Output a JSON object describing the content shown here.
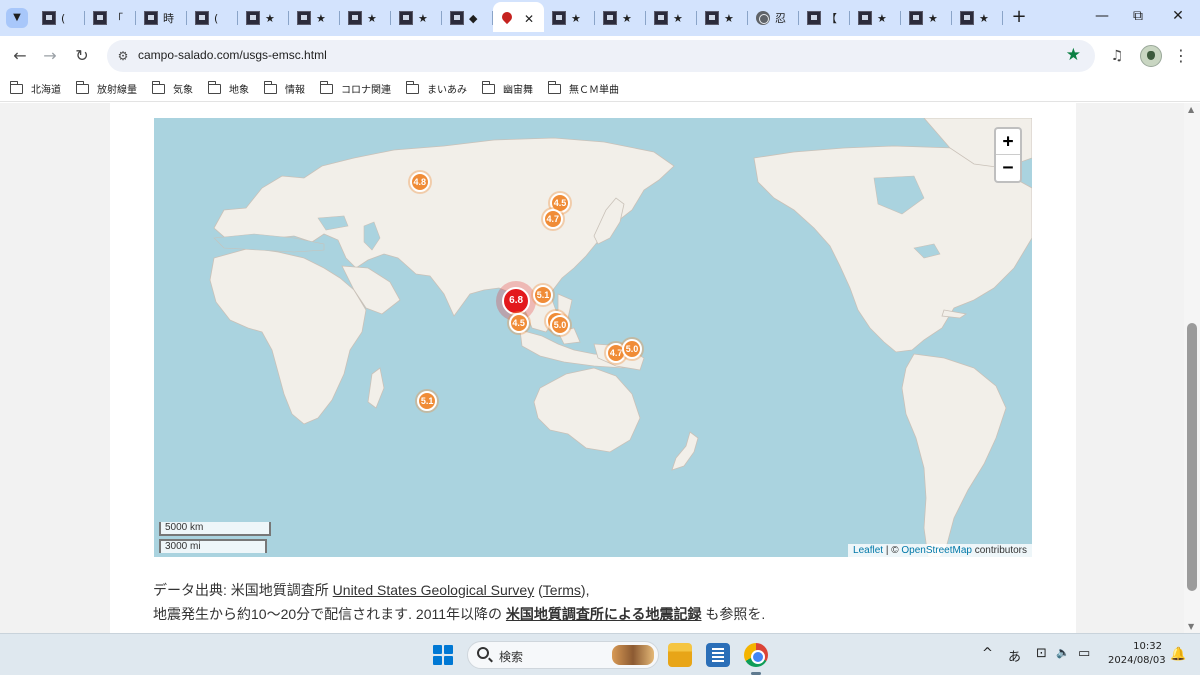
{
  "tabstrip": {
    "tabs": [
      {
        "glyph": "(",
        "icon": "site-icon"
      },
      {
        "glyph": "「",
        "icon": "site-icon"
      },
      {
        "glyph": "時",
        "icon": "site-icon"
      },
      {
        "glyph": "(",
        "icon": "site-icon"
      },
      {
        "glyph": "★",
        "icon": "site-icon"
      },
      {
        "glyph": "★",
        "icon": "site-icon"
      },
      {
        "glyph": "★",
        "icon": "site-icon"
      },
      {
        "glyph": "★",
        "icon": "site-icon"
      },
      {
        "glyph": "◆",
        "icon": "site-icon"
      },
      {
        "glyph": "",
        "icon": "map-pin-icon",
        "active": true
      },
      {
        "glyph": "★",
        "icon": "site-icon"
      },
      {
        "glyph": "★",
        "icon": "site-icon"
      },
      {
        "glyph": "★",
        "icon": "site-icon"
      },
      {
        "glyph": "★",
        "icon": "site-icon"
      },
      {
        "glyph": "忍",
        "icon": "globe-icon"
      },
      {
        "glyph": "【",
        "icon": "site-icon"
      },
      {
        "glyph": "★",
        "icon": "site-icon"
      },
      {
        "glyph": "★",
        "icon": "site-icon"
      },
      {
        "glyph": "★",
        "icon": "site-icon"
      }
    ],
    "close_glyph": "✕",
    "new_tab_glyph": "+",
    "minimize_glyph": "—",
    "restore_glyph": "⧉",
    "close_window_glyph": "✕"
  },
  "toolbar": {
    "url": "campo-salado.com/usgs-emsc.html",
    "back_glyph": "←",
    "forward_glyph": "→",
    "reload_glyph": "↻",
    "site_info_glyph": "⚙",
    "bookmark_star_glyph": "★",
    "media_glyph": "♫"
  },
  "bookmarks": [
    "北海道",
    "放射線量",
    "気象",
    "地象",
    "情報",
    "コロナ関連",
    "まいあみ",
    "幽宙舞",
    "無ＣＭ単曲"
  ],
  "map": {
    "zoom_in": "+",
    "zoom_out": "−",
    "scale_km": "5000 km",
    "scale_mi": "3000 mi",
    "attribution": {
      "leaflet": "Leaflet",
      "separator": " | © ",
      "osm": "OpenStreetMap",
      "suffix": " contributors"
    },
    "colors": {
      "ocean": "#aad3df",
      "land": "#f2efe9",
      "cluster": "#f08c37",
      "cluster_large": "#e3191c"
    },
    "markers": [
      {
        "label": "4.8",
        "lon": 87.0,
        "lat": 48.0
      },
      {
        "label": "4.5",
        "lon": 144.5,
        "lat": 42.0
      },
      {
        "label": "4.7",
        "lon": 141.5,
        "lat": 37.0
      },
      {
        "label": "6.8",
        "lon": 126.5,
        "lat": 6.0,
        "large": true
      },
      {
        "label": "5.1",
        "lon": 137.5,
        "lat": 8.5
      },
      {
        "label": "4.5",
        "lon": 127.5,
        "lat": -3.0
      },
      {
        "label": "4.6",
        "lon": 143.0,
        "lat": -2.0
      },
      {
        "label": "5.0",
        "lon": 144.5,
        "lat": -3.5
      },
      {
        "label": "4.7",
        "lon": 167.5,
        "lat": -15.0
      },
      {
        "label": "5.0",
        "lon": 174.0,
        "lat": -13.5
      },
      {
        "label": "5.1",
        "lon": 90.0,
        "lat": -33.0
      }
    ]
  },
  "source": {
    "line1_prefix": "データ出典: 米国地質調査所 ",
    "usgs_link": "United States Geological Survey",
    "paren_open": " (",
    "terms_link": "Terms",
    "paren_close": "),",
    "line2_prefix": "地震発生から約10〜20分で配信されます. 2011年以降の ",
    "records_link": "米国地質調査所による地震記録",
    "line2_suffix": " も参照を."
  },
  "taskbar": {
    "search_label": "検索",
    "tray_chevron": "^",
    "ime": "あ",
    "clock_time": "10:32",
    "clock_date": "2024/08/03",
    "notification_glyph": "🔔",
    "network_glyph": "⊡",
    "volume_glyph": "🔈",
    "battery_glyph": "▭"
  }
}
